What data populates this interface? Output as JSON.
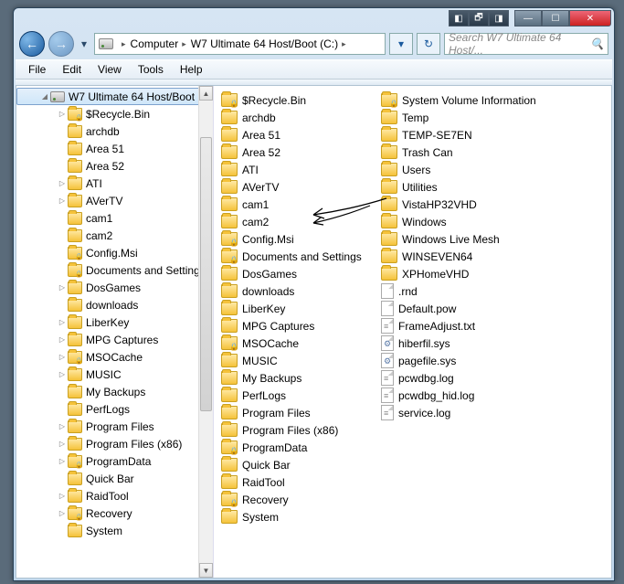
{
  "titlebar": {
    "restore_down": "🗗",
    "snap_left": "◧",
    "snap_right": "◨",
    "minimize": "—",
    "maximize": "☐",
    "close": "✕"
  },
  "nav": {
    "back": "←",
    "forward": "→",
    "dropdown": "▾"
  },
  "breadcrumb": {
    "root_chev": "▸",
    "computer": "Computer",
    "drive": "W7 Ultimate 64 Host/Boot (C:)",
    "chev": "▸"
  },
  "refresh_glyph": "↻",
  "search": {
    "placeholder": "Search W7 Ultimate 64 Host/...",
    "glyph": "🔍"
  },
  "menu": {
    "file": "File",
    "edit": "Edit",
    "view": "View",
    "tools": "Tools",
    "help": "Help"
  },
  "tree": {
    "root": {
      "label": "W7 Ultimate 64 Host/Boot",
      "expanded": true
    },
    "items": [
      {
        "label": "$Recycle.Bin",
        "exp": "▷",
        "lock": true,
        "indent": 1
      },
      {
        "label": "archdb",
        "exp": "",
        "indent": 1
      },
      {
        "label": "Area 51",
        "exp": "",
        "indent": 1
      },
      {
        "label": "Area 52",
        "exp": "",
        "indent": 1
      },
      {
        "label": "ATI",
        "exp": "▷",
        "indent": 1
      },
      {
        "label": "AVerTV",
        "exp": "▷",
        "indent": 1
      },
      {
        "label": "cam1",
        "exp": "",
        "indent": 1
      },
      {
        "label": "cam2",
        "exp": "",
        "indent": 1
      },
      {
        "label": "Config.Msi",
        "exp": "",
        "lock": true,
        "indent": 1
      },
      {
        "label": "Documents and Settings",
        "exp": "",
        "lock": true,
        "indent": 1
      },
      {
        "label": "DosGames",
        "exp": "▷",
        "indent": 1
      },
      {
        "label": "downloads",
        "exp": "",
        "indent": 1
      },
      {
        "label": "LiberKey",
        "exp": "▷",
        "indent": 1
      },
      {
        "label": "MPG Captures",
        "exp": "▷",
        "indent": 1
      },
      {
        "label": "MSOCache",
        "exp": "▷",
        "lock": true,
        "indent": 1
      },
      {
        "label": "MUSIC",
        "exp": "▷",
        "indent": 1
      },
      {
        "label": "My Backups",
        "exp": "",
        "indent": 1
      },
      {
        "label": "PerfLogs",
        "exp": "",
        "indent": 1
      },
      {
        "label": "Program Files",
        "exp": "▷",
        "indent": 1
      },
      {
        "label": "Program Files (x86)",
        "exp": "▷",
        "indent": 1
      },
      {
        "label": "ProgramData",
        "exp": "▷",
        "lock": true,
        "indent": 1
      },
      {
        "label": "Quick Bar",
        "exp": "",
        "indent": 1
      },
      {
        "label": "RaidTool",
        "exp": "▷",
        "indent": 1
      },
      {
        "label": "Recovery",
        "exp": "▷",
        "lock": true,
        "indent": 1
      },
      {
        "label": "System",
        "exp": "",
        "indent": 1
      }
    ]
  },
  "scrollbar": {
    "up": "▲",
    "down": "▼"
  },
  "list": {
    "col1": [
      {
        "name": "$Recycle.Bin",
        "type": "folder",
        "lock": true
      },
      {
        "name": "archdb",
        "type": "folder"
      },
      {
        "name": "Area 51",
        "type": "folder"
      },
      {
        "name": "Area 52",
        "type": "folder"
      },
      {
        "name": "ATI",
        "type": "folder"
      },
      {
        "name": "AVerTV",
        "type": "folder"
      },
      {
        "name": "cam1",
        "type": "folder"
      },
      {
        "name": "cam2",
        "type": "folder"
      },
      {
        "name": "Config.Msi",
        "type": "folder",
        "lock": true
      },
      {
        "name": "Documents and Settings",
        "type": "folder",
        "lock": true
      },
      {
        "name": "DosGames",
        "type": "folder"
      },
      {
        "name": "downloads",
        "type": "folder"
      },
      {
        "name": "LiberKey",
        "type": "folder"
      },
      {
        "name": "MPG Captures",
        "type": "folder"
      },
      {
        "name": "MSOCache",
        "type": "folder",
        "lock": true
      },
      {
        "name": "MUSIC",
        "type": "folder"
      },
      {
        "name": "My Backups",
        "type": "folder"
      },
      {
        "name": "PerfLogs",
        "type": "folder"
      },
      {
        "name": "Program Files",
        "type": "folder"
      },
      {
        "name": "Program Files (x86)",
        "type": "folder"
      },
      {
        "name": "ProgramData",
        "type": "folder",
        "lock": true
      },
      {
        "name": "Quick Bar",
        "type": "folder"
      },
      {
        "name": "RaidTool",
        "type": "folder"
      },
      {
        "name": "Recovery",
        "type": "folder",
        "lock": true
      },
      {
        "name": "System",
        "type": "folder"
      }
    ],
    "col2": [
      {
        "name": "System Volume Information",
        "type": "folder",
        "lock": true
      },
      {
        "name": "Temp",
        "type": "folder"
      },
      {
        "name": "TEMP-SE7EN",
        "type": "folder"
      },
      {
        "name": "Trash Can",
        "type": "folder"
      },
      {
        "name": "Users",
        "type": "folder"
      },
      {
        "name": "Utilities",
        "type": "folder"
      },
      {
        "name": "VistaHP32VHD",
        "type": "folder"
      },
      {
        "name": "Windows",
        "type": "folder"
      },
      {
        "name": "Windows Live Mesh",
        "type": "folder"
      },
      {
        "name": "WINSEVEN64",
        "type": "folder"
      },
      {
        "name": "XPHomeVHD",
        "type": "folder"
      },
      {
        "name": ".rnd",
        "type": "file"
      },
      {
        "name": "Default.pow",
        "type": "file"
      },
      {
        "name": "FrameAdjust.txt",
        "type": "file",
        "sub": "txt"
      },
      {
        "name": "hiberfil.sys",
        "type": "file",
        "sub": "sys"
      },
      {
        "name": "pagefile.sys",
        "type": "file",
        "sub": "sys"
      },
      {
        "name": "pcwdbg.log",
        "type": "file",
        "sub": "txt"
      },
      {
        "name": "pcwdbg_hid.log",
        "type": "file",
        "sub": "txt"
      },
      {
        "name": "service.log",
        "type": "file",
        "sub": "txt"
      }
    ]
  }
}
